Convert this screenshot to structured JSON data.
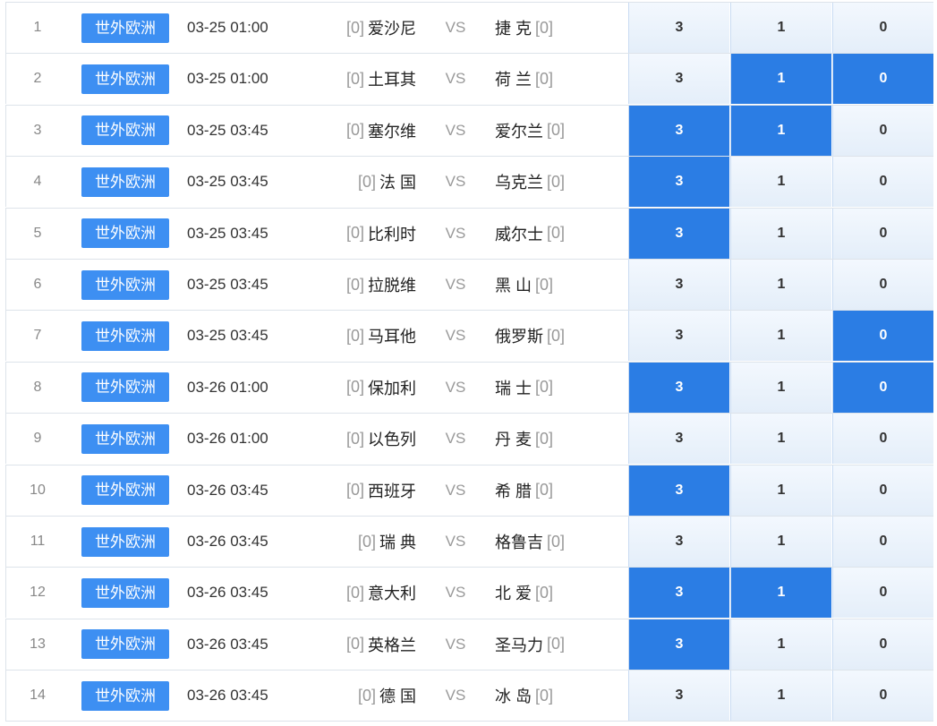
{
  "colors": {
    "league_badge": "#3d8ff2",
    "selected_odd": "#2b7de4",
    "odd_cell": "#eaf2fb",
    "vs_text": "#999999",
    "rank_text": "#999999"
  },
  "matches": [
    {
      "index": "1",
      "league": "世外欧洲",
      "time": "03-25 01:00",
      "home_rank": "[0]",
      "home": "爱沙尼",
      "vs": "VS",
      "away": "捷 克",
      "away_rank": "[0]",
      "odds": [
        {
          "label": "3",
          "selected": false
        },
        {
          "label": "1",
          "selected": false
        },
        {
          "label": "0",
          "selected": false
        }
      ]
    },
    {
      "index": "2",
      "league": "世外欧洲",
      "time": "03-25 01:00",
      "home_rank": "[0]",
      "home": "土耳其",
      "vs": "VS",
      "away": "荷 兰",
      "away_rank": "[0]",
      "odds": [
        {
          "label": "3",
          "selected": false
        },
        {
          "label": "1",
          "selected": true
        },
        {
          "label": "0",
          "selected": true
        }
      ]
    },
    {
      "index": "3",
      "league": "世外欧洲",
      "time": "03-25 03:45",
      "home_rank": "[0]",
      "home": "塞尔维",
      "vs": "VS",
      "away": "爱尔兰",
      "away_rank": "[0]",
      "odds": [
        {
          "label": "3",
          "selected": true
        },
        {
          "label": "1",
          "selected": true
        },
        {
          "label": "0",
          "selected": false
        }
      ]
    },
    {
      "index": "4",
      "league": "世外欧洲",
      "time": "03-25 03:45",
      "home_rank": "[0]",
      "home": "法 国",
      "vs": "VS",
      "away": "乌克兰",
      "away_rank": "[0]",
      "odds": [
        {
          "label": "3",
          "selected": true
        },
        {
          "label": "1",
          "selected": false
        },
        {
          "label": "0",
          "selected": false
        }
      ]
    },
    {
      "index": "5",
      "league": "世外欧洲",
      "time": "03-25 03:45",
      "home_rank": "[0]",
      "home": "比利时",
      "vs": "VS",
      "away": "威尔士",
      "away_rank": "[0]",
      "odds": [
        {
          "label": "3",
          "selected": true
        },
        {
          "label": "1",
          "selected": false
        },
        {
          "label": "0",
          "selected": false
        }
      ]
    },
    {
      "index": "6",
      "league": "世外欧洲",
      "time": "03-25 03:45",
      "home_rank": "[0]",
      "home": "拉脱维",
      "vs": "VS",
      "away": "黑 山",
      "away_rank": "[0]",
      "odds": [
        {
          "label": "3",
          "selected": false
        },
        {
          "label": "1",
          "selected": false
        },
        {
          "label": "0",
          "selected": false
        }
      ]
    },
    {
      "index": "7",
      "league": "世外欧洲",
      "time": "03-25 03:45",
      "home_rank": "[0]",
      "home": "马耳他",
      "vs": "VS",
      "away": "俄罗斯",
      "away_rank": "[0]",
      "odds": [
        {
          "label": "3",
          "selected": false
        },
        {
          "label": "1",
          "selected": false
        },
        {
          "label": "0",
          "selected": true
        }
      ]
    },
    {
      "index": "8",
      "league": "世外欧洲",
      "time": "03-26 01:00",
      "home_rank": "[0]",
      "home": "保加利",
      "vs": "VS",
      "away": "瑞 士",
      "away_rank": "[0]",
      "odds": [
        {
          "label": "3",
          "selected": true
        },
        {
          "label": "1",
          "selected": false
        },
        {
          "label": "0",
          "selected": true
        }
      ]
    },
    {
      "index": "9",
      "league": "世外欧洲",
      "time": "03-26 01:00",
      "home_rank": "[0]",
      "home": "以色列",
      "vs": "VS",
      "away": "丹 麦",
      "away_rank": "[0]",
      "odds": [
        {
          "label": "3",
          "selected": false
        },
        {
          "label": "1",
          "selected": false
        },
        {
          "label": "0",
          "selected": false
        }
      ]
    },
    {
      "index": "10",
      "league": "世外欧洲",
      "time": "03-26 03:45",
      "home_rank": "[0]",
      "home": "西班牙",
      "vs": "VS",
      "away": "希 腊",
      "away_rank": "[0]",
      "odds": [
        {
          "label": "3",
          "selected": true
        },
        {
          "label": "1",
          "selected": false
        },
        {
          "label": "0",
          "selected": false
        }
      ]
    },
    {
      "index": "11",
      "league": "世外欧洲",
      "time": "03-26 03:45",
      "home_rank": "[0]",
      "home": "瑞 典",
      "vs": "VS",
      "away": "格鲁吉",
      "away_rank": "[0]",
      "odds": [
        {
          "label": "3",
          "selected": false
        },
        {
          "label": "1",
          "selected": false
        },
        {
          "label": "0",
          "selected": false
        }
      ]
    },
    {
      "index": "12",
      "league": "世外欧洲",
      "time": "03-26 03:45",
      "home_rank": "[0]",
      "home": "意大利",
      "vs": "VS",
      "away": "北 爱",
      "away_rank": "[0]",
      "odds": [
        {
          "label": "3",
          "selected": true
        },
        {
          "label": "1",
          "selected": true
        },
        {
          "label": "0",
          "selected": false
        }
      ]
    },
    {
      "index": "13",
      "league": "世外欧洲",
      "time": "03-26 03:45",
      "home_rank": "[0]",
      "home": "英格兰",
      "vs": "VS",
      "away": "圣马力",
      "away_rank": "[0]",
      "odds": [
        {
          "label": "3",
          "selected": true
        },
        {
          "label": "1",
          "selected": false
        },
        {
          "label": "0",
          "selected": false
        }
      ]
    },
    {
      "index": "14",
      "league": "世外欧洲",
      "time": "03-26 03:45",
      "home_rank": "[0]",
      "home": "德 国",
      "vs": "VS",
      "away": "冰 岛",
      "away_rank": "[0]",
      "odds": [
        {
          "label": "3",
          "selected": false
        },
        {
          "label": "1",
          "selected": false
        },
        {
          "label": "0",
          "selected": false
        }
      ]
    }
  ]
}
